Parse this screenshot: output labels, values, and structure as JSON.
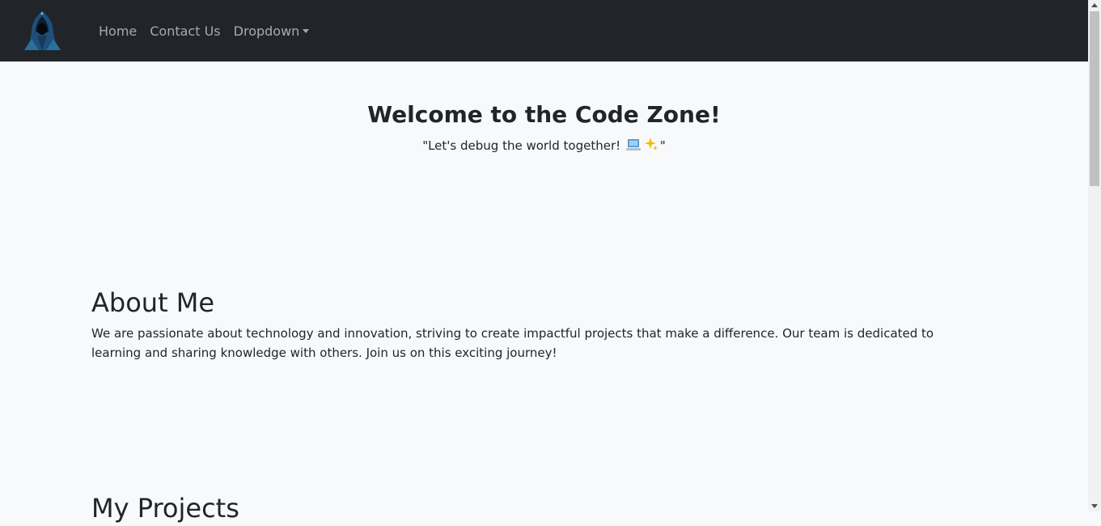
{
  "navbar": {
    "logo_icon": "hooded-hacker-icon",
    "links": [
      {
        "label": "Home"
      },
      {
        "label": "Contact Us"
      },
      {
        "label": "Dropdown"
      }
    ]
  },
  "hero": {
    "title": "Welcome to the Code Zone!",
    "tagline_start": "\"Let's debug the world together!",
    "tagline_emojis": [
      "laptop-emoji",
      "sparkles-emoji"
    ],
    "tagline_end": "\""
  },
  "about": {
    "heading": "About Me",
    "text": "We are passionate about technology and innovation, striving to create impactful projects that make a difference. Our team is dedicated to learning and sharing knowledge with others. Join us on this exciting journey!"
  },
  "projects": {
    "heading": "My Projects"
  },
  "colors": {
    "navbar_bg": "#212529",
    "page_bg": "#f8f9fa",
    "text": "#212529"
  }
}
